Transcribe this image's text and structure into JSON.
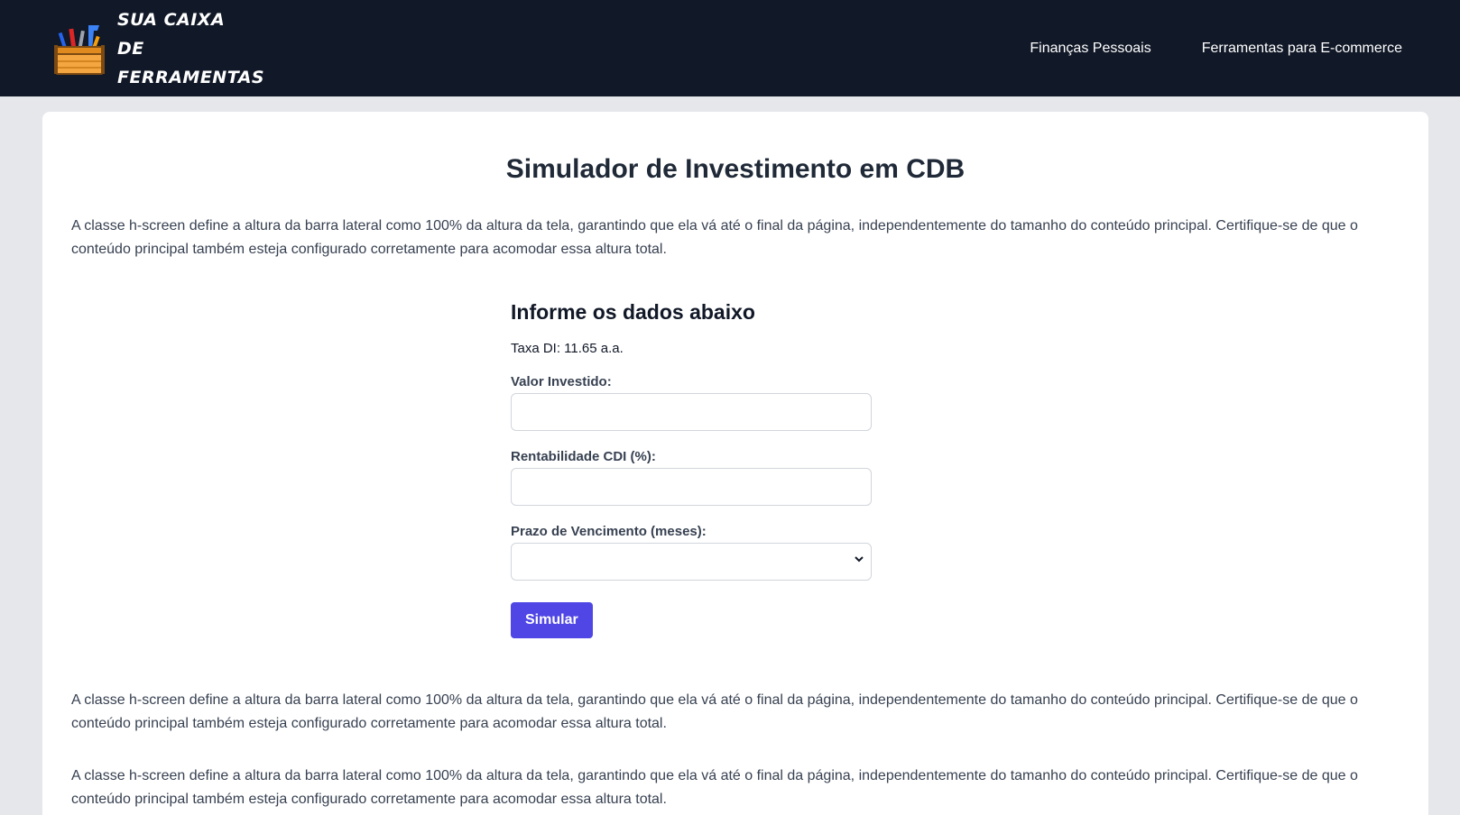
{
  "brand": {
    "line1": "SUA CAIXA DE",
    "line2": "FERRAMENTAS",
    "logo_icon": "toolbox-icon"
  },
  "nav": {
    "items": [
      {
        "label": "Finanças Pessoais"
      },
      {
        "label": "Ferramentas para E-commerce"
      }
    ]
  },
  "main": {
    "title": "Simulador de Investimento em CDB",
    "intro": "A classe h-screen define a altura da barra lateral como 100% da altura da tela, garantindo que ela vá até o final da página, independentemente do tamanho do conteúdo principal. Certifique-se de que o conteúdo principal também esteja configurado corretamente para acomodar essa altura total.",
    "outro1": "A classe h-screen define a altura da barra lateral como 100% da altura da tela, garantindo que ela vá até o final da página, independentemente do tamanho do conteúdo principal. Certifique-se de que o conteúdo principal também esteja configurado corretamente para acomodar essa altura total.",
    "outro2": "A classe h-screen define a altura da barra lateral como 100% da altura da tela, garantindo que ela vá até o final da página, independentemente do tamanho do conteúdo principal. Certifique-se de que o conteúdo principal também esteja configurado corretamente para acomodar essa altura total."
  },
  "form": {
    "title": "Informe os dados abaixo",
    "rate": "Taxa DI: 11.65 a.a.",
    "invested_label": "Valor Investido:",
    "invested_value": "",
    "cdi_label": "Rentabilidade CDI (%):",
    "cdi_value": "",
    "term_label": "Prazo de Vencimento (meses):",
    "term_selected": "",
    "submit_label": "Simular"
  },
  "colors": {
    "navbar": "#111827",
    "accent": "#4f46e5",
    "background": "#e5e7eb"
  }
}
